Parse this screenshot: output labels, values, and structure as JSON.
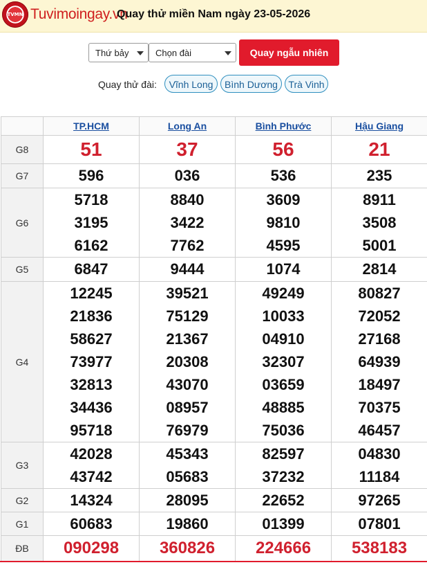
{
  "header": {
    "logo_text": "TVMN",
    "site_name": "Tuvimoingay.vn",
    "title": "Quay thử miền Nam ngày 23-05-2026"
  },
  "controls": {
    "day_select": "Thứ bảy",
    "station_select": "Chọn đài",
    "spin_button": "Quay ngẫu nhiên",
    "station_label": "Quay thử đài:",
    "stations": [
      "Vĩnh Long",
      "Bình Dương",
      "Trà Vinh"
    ]
  },
  "colors": {
    "accent_red": "#e11b2c",
    "header_bg": "#fdf6d3",
    "link_blue": "#1a4fa0"
  },
  "table": {
    "columns": [
      "TP.HCM",
      "Long An",
      "Bình Phước",
      "Hậu Giang"
    ],
    "prizes": [
      {
        "label": "G8",
        "values": [
          [
            "51"
          ],
          [
            "37"
          ],
          [
            "56"
          ],
          [
            "21"
          ]
        ]
      },
      {
        "label": "G7",
        "values": [
          [
            "596"
          ],
          [
            "036"
          ],
          [
            "536"
          ],
          [
            "235"
          ]
        ]
      },
      {
        "label": "G6",
        "values": [
          [
            "5718",
            "3195",
            "6162"
          ],
          [
            "8840",
            "3422",
            "7762"
          ],
          [
            "3609",
            "9810",
            "4595"
          ],
          [
            "8911",
            "3508",
            "5001"
          ]
        ]
      },
      {
        "label": "G5",
        "values": [
          [
            "6847"
          ],
          [
            "9444"
          ],
          [
            "1074"
          ],
          [
            "2814"
          ]
        ]
      },
      {
        "label": "G4",
        "values": [
          [
            "12245",
            "21836",
            "58627",
            "73977",
            "32813",
            "34436",
            "95718"
          ],
          [
            "39521",
            "75129",
            "21367",
            "20308",
            "43070",
            "08957",
            "76979"
          ],
          [
            "49249",
            "10033",
            "04910",
            "32307",
            "03659",
            "48885",
            "75036"
          ],
          [
            "80827",
            "72052",
            "27168",
            "64939",
            "18497",
            "70375",
            "46457"
          ]
        ]
      },
      {
        "label": "G3",
        "values": [
          [
            "42028",
            "43742"
          ],
          [
            "45343",
            "05683"
          ],
          [
            "82597",
            "37232"
          ],
          [
            "04830",
            "11184"
          ]
        ]
      },
      {
        "label": "G2",
        "values": [
          [
            "14324"
          ],
          [
            "28095"
          ],
          [
            "22652"
          ],
          [
            "97265"
          ]
        ]
      },
      {
        "label": "G1",
        "values": [
          [
            "60683"
          ],
          [
            "19860"
          ],
          [
            "01399"
          ],
          [
            "07801"
          ]
        ]
      },
      {
        "label": "ĐB",
        "values": [
          [
            "090298"
          ],
          [
            "360826"
          ],
          [
            "224666"
          ],
          [
            "538183"
          ]
        ]
      }
    ]
  }
}
